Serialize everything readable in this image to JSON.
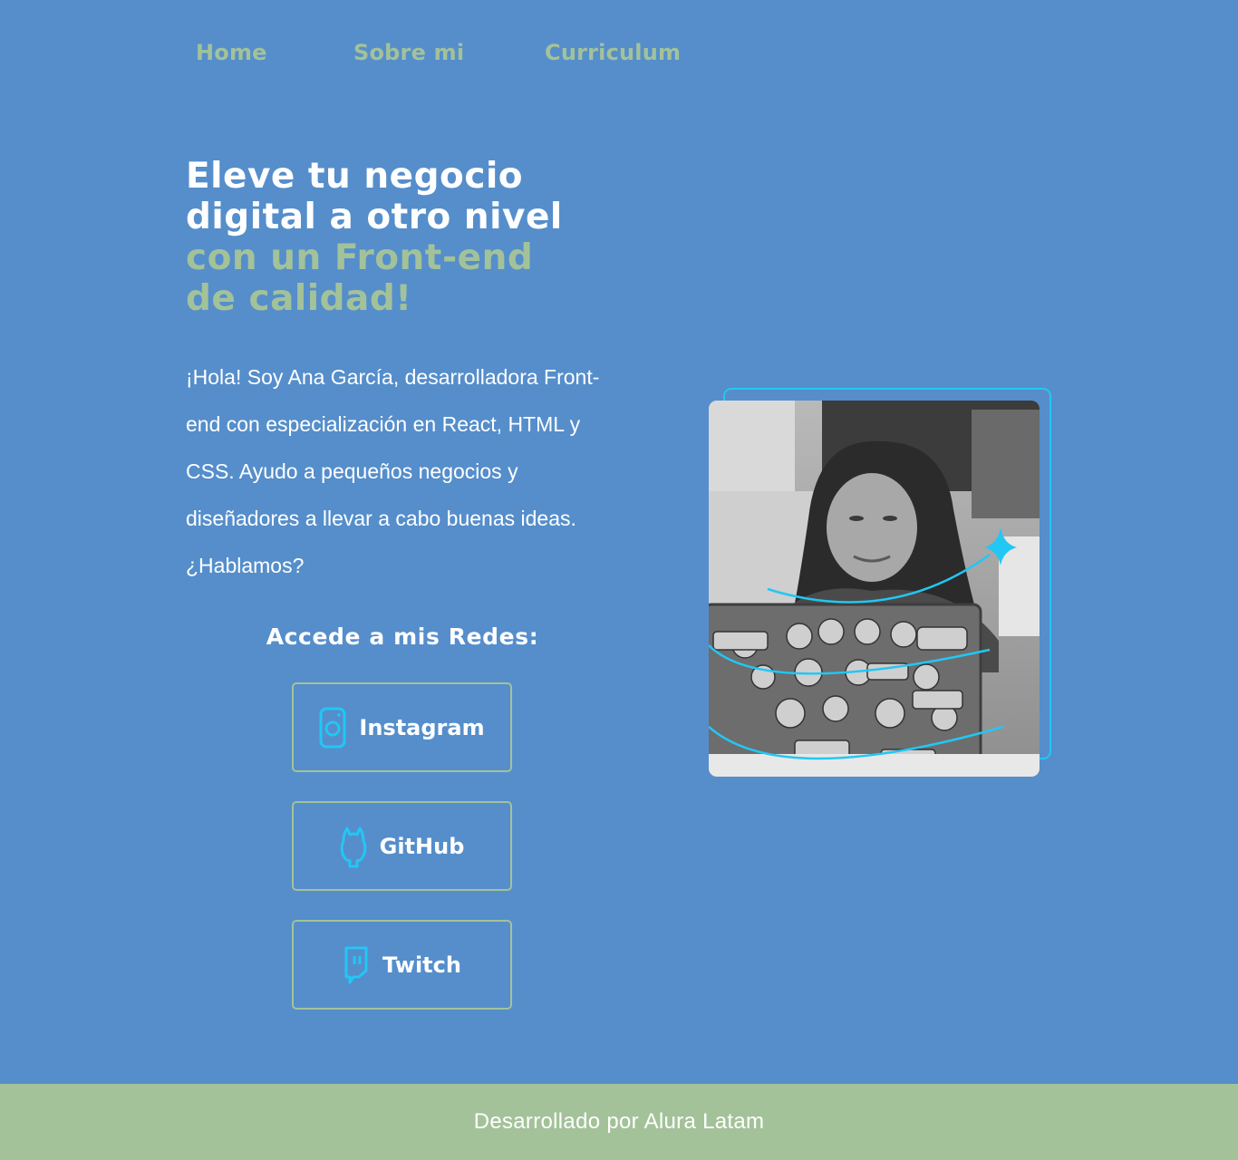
{
  "nav": {
    "items": [
      {
        "label": "Home"
      },
      {
        "label": "Sobre mi"
      },
      {
        "label": "Curriculum"
      }
    ]
  },
  "hero": {
    "title_line1": "Eleve tu negocio",
    "title_line2": "digital a otro nivel",
    "title_line3": "con un Front-end",
    "title_line4": "de calidad!",
    "intro": "¡Hola! Soy Ana García, desarrolladora Front-end con especialización en React, HTML y CSS. Ayudo a pequeños negocios y diseñadores a llevar a cabo buenas ideas. ¿Hablamos?"
  },
  "social": {
    "title": "Accede a mis Redes:",
    "buttons": [
      {
        "label": "Instagram",
        "icon": "instagram-icon"
      },
      {
        "label": "GitHub",
        "icon": "github-icon"
      },
      {
        "label": "Twitch",
        "icon": "twitch-icon"
      }
    ]
  },
  "photo": {
    "subject": "profile-photo"
  },
  "footer": {
    "text": "Desarrollado por Alura Latam"
  },
  "colors": {
    "background": "#558ECB",
    "accent_green": "#A3C299",
    "accent_cyan": "#22C7F4",
    "text": "#FFFFFF"
  }
}
